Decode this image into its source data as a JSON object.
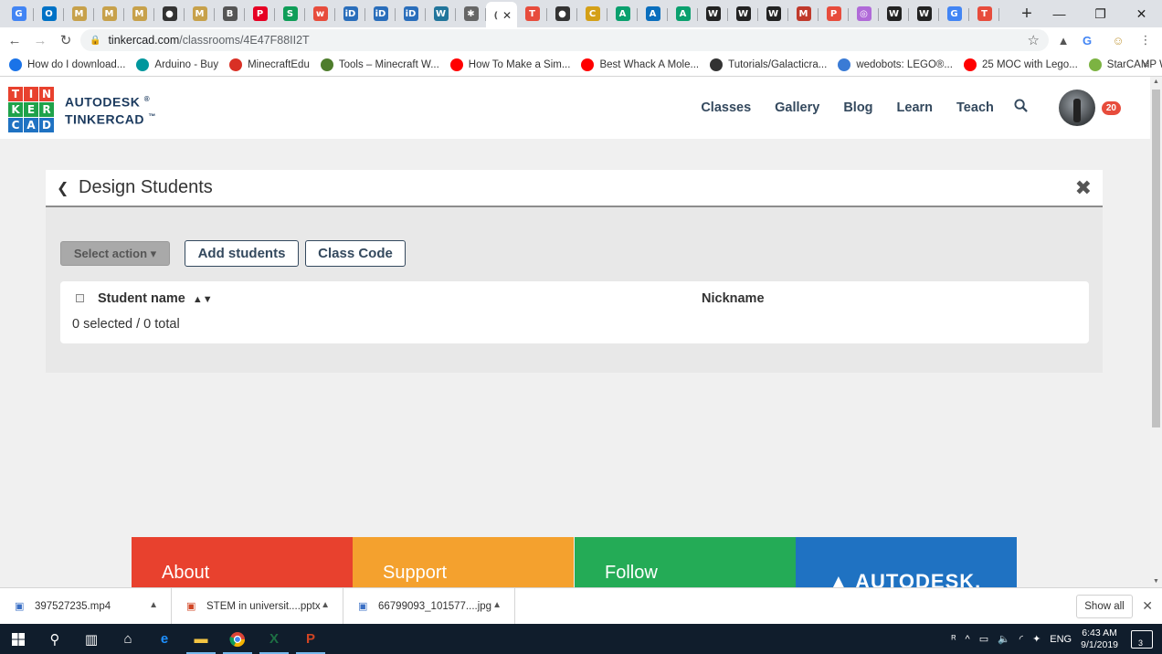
{
  "browser": {
    "tabs": [
      {
        "icon": "translate-icon",
        "glyph": "G",
        "color": "#4285f4"
      },
      {
        "icon": "outlook-icon",
        "glyph": "O",
        "color": "#0072c6"
      },
      {
        "icon": "minecraft-edu-icon",
        "glyph": "M",
        "color": "#c7a14b"
      },
      {
        "icon": "minecraft-edu-icon",
        "glyph": "M",
        "color": "#c7a14b"
      },
      {
        "icon": "minecraft-edu-icon",
        "glyph": "M",
        "color": "#c7a14b"
      },
      {
        "icon": "github-icon",
        "glyph": "●",
        "color": "#333333"
      },
      {
        "icon": "minecraft-edu-icon",
        "glyph": "M",
        "color": "#c7a14b"
      },
      {
        "icon": "book-icon",
        "glyph": "B",
        "color": "#555555"
      },
      {
        "icon": "pinterest-icon",
        "glyph": "P",
        "color": "#e60023"
      },
      {
        "icon": "sheets-icon",
        "glyph": "S",
        "color": "#0f9d58"
      },
      {
        "icon": "script-icon",
        "glyph": "w",
        "color": "#e74c3c"
      },
      {
        "icon": "id-icon",
        "glyph": "iD",
        "color": "#2a6ebb"
      },
      {
        "icon": "id-icon",
        "glyph": "iD",
        "color": "#2a6ebb"
      },
      {
        "icon": "id-icon",
        "glyph": "iD",
        "color": "#2a6ebb"
      },
      {
        "icon": "wordpress-icon",
        "glyph": "W",
        "color": "#21759b"
      },
      {
        "icon": "gear-icon",
        "glyph": "✱",
        "color": "#666666"
      },
      {
        "icon": "loading-icon",
        "glyph": "(",
        "color": "#777777",
        "active": true
      },
      {
        "icon": "tinkercad-icon",
        "glyph": "T",
        "color": "#e74c3c"
      },
      {
        "icon": "github-icon",
        "glyph": "●",
        "color": "#333333"
      },
      {
        "icon": "mail-icon",
        "glyph": "C",
        "color": "#d4a017"
      },
      {
        "icon": "adobe-icon",
        "glyph": "A",
        "color": "#0aa06e"
      },
      {
        "icon": "adobe-icon",
        "glyph": "A",
        "color": "#0a6ebd"
      },
      {
        "icon": "adobe-icon",
        "glyph": "A",
        "color": "#0aa06e"
      },
      {
        "icon": "wikipedia-icon",
        "glyph": "W",
        "color": "#222222"
      },
      {
        "icon": "wikipedia-icon",
        "glyph": "W",
        "color": "#222222"
      },
      {
        "icon": "wikipedia-icon",
        "glyph": "W",
        "color": "#222222"
      },
      {
        "icon": "mc-icon",
        "glyph": "M",
        "color": "#c0392b"
      },
      {
        "icon": "pin-icon",
        "glyph": "P",
        "color": "#e74c3c"
      },
      {
        "icon": "circle-icon",
        "glyph": "◎",
        "color": "#b06ad8"
      },
      {
        "icon": "wikipedia-icon",
        "glyph": "W",
        "color": "#222222"
      },
      {
        "icon": "wikipedia-icon",
        "glyph": "W",
        "color": "#222222"
      },
      {
        "icon": "google-icon",
        "glyph": "G",
        "color": "#4285f4"
      },
      {
        "icon": "tinkercad-icon",
        "glyph": "T",
        "color": "#e74c3c"
      }
    ],
    "url_host": "tinkercad.com",
    "url_path": "/classrooms/4E47F88II2T",
    "bookmarks": [
      {
        "label": "How do I download...",
        "icon": "info-icon",
        "color": "#1a73e8"
      },
      {
        "label": "Arduino - Buy",
        "icon": "arduino-icon",
        "color": "#00979d"
      },
      {
        "label": "MinecraftEdu",
        "icon": "apple-icon",
        "color": "#d93025"
      },
      {
        "label": "Tools – Minecraft W...",
        "icon": "block-icon",
        "color": "#4e7d2c"
      },
      {
        "label": "How To Make a Sim...",
        "icon": "youtube-icon",
        "color": "#ff0000"
      },
      {
        "label": "Best Whack A Mole...",
        "icon": "youtube-icon",
        "color": "#ff0000"
      },
      {
        "label": "Tutorials/Galacticra...",
        "icon": "github-icon",
        "color": "#333333"
      },
      {
        "label": "wedobots: LEGO®...",
        "icon": "robot-icon",
        "color": "#3a7bd5"
      },
      {
        "label": "25 MOC with Lego...",
        "icon": "youtube-icon",
        "color": "#ff0000"
      },
      {
        "label": "StarCAMP WeDo | L...",
        "icon": "star-icon",
        "color": "#7cb342"
      }
    ]
  },
  "site": {
    "logo_letters": [
      "T",
      "I",
      "N",
      "K",
      "E",
      "R",
      "C",
      "A",
      "D"
    ],
    "logo_colors": [
      "#e8412e",
      "#e8412e",
      "#e8412e",
      "#1fa24a",
      "#1fa24a",
      "#1fa24a",
      "#1f72c2",
      "#1f72c2",
      "#1f72c2"
    ],
    "brand_line1": "AUTODESK",
    "brand_line1_mark": "®",
    "brand_line2": "TINKERCAD",
    "brand_line2_mark": "™",
    "nav": [
      "Classes",
      "Gallery",
      "Blog",
      "Learn",
      "Teach"
    ],
    "notification_count": "20"
  },
  "panel": {
    "title": "Design Students",
    "select_action": "Select action ▾",
    "add_students": "Add students",
    "class_code": "Class Code",
    "col_student_name": "Student name",
    "col_nickname": "Nickname",
    "count_text": "0 selected / 0 total"
  },
  "footer": [
    {
      "label": "About",
      "color": "#e8412e"
    },
    {
      "label": "Support",
      "color": "#f4a12e"
    },
    {
      "label": "Follow",
      "color": "#24ab56"
    },
    {
      "label": "AUTODESK.",
      "color": "#1f72c2"
    }
  ],
  "downloads": [
    {
      "name": "397527235.mp4",
      "icon": "video-file-icon"
    },
    {
      "name": "STEM in universit....pptx",
      "icon": "pptx-file-icon"
    },
    {
      "name": "66799093_101577....jpg",
      "icon": "image-file-icon"
    }
  ],
  "downloads_show_all": "Show all",
  "taskbar": {
    "language": "ENG",
    "time": "6:43 AM",
    "date": "9/1/2019",
    "notifications": "3"
  }
}
